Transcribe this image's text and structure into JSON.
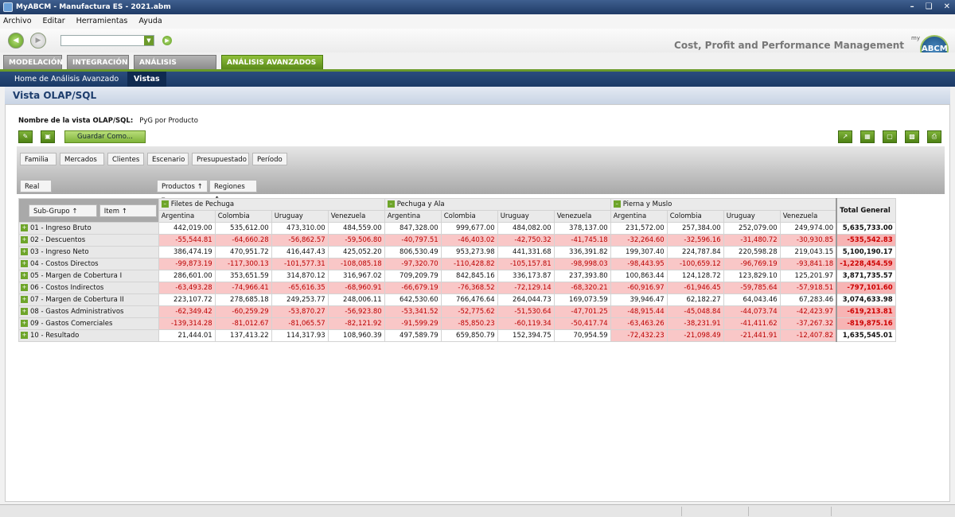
{
  "window": {
    "title": "MyABCM - Manufactura ES - 2021.abm"
  },
  "menu": [
    "Archivo",
    "Editar",
    "Herramientas",
    "Ayuda"
  ],
  "brand": {
    "tagline": "Cost, Profit and Performance Management",
    "logo_small": "my",
    "logo": "ABCM"
  },
  "tabs": [
    "MODELACIÓN",
    "INTEGRACIÓN",
    "ANÁLISIS BÁSICOS",
    "ANÁLISIS AVANZADOS"
  ],
  "active_tab": "ANÁLISIS AVANZADOS",
  "subnav": {
    "home": "Home de Análisis Avanzado",
    "current": "Vistas"
  },
  "page": {
    "title": "Vista OLAP/SQL",
    "view_label": "Nombre de la vista OLAP/SQL:",
    "view_name": "PyG por Producto",
    "save_as": "Guardar Como..."
  },
  "filters": [
    "Familia",
    "Mercados",
    "Clientes",
    "Escenario",
    "Presupuestado",
    "Período"
  ],
  "row_filter": "Real",
  "column_fields": [
    "Productos",
    "Regiones"
  ],
  "row_fields": [
    "Sub-Grupo",
    "Item"
  ],
  "products": [
    "Filetes de Pechuga",
    "Pechuga y Ala",
    "Pierna y Muslo"
  ],
  "regions": [
    "Argentina",
    "Colombia",
    "Uruguay",
    "Venezuela"
  ],
  "total_label": "Total General",
  "rows": [
    {
      "label": "01 - Ingreso Bruto",
      "values": [
        "442,019.00",
        "535,612.00",
        "473,310.00",
        "484,559.00",
        "847,328.00",
        "999,677.00",
        "484,082.00",
        "378,137.00",
        "231,572.00",
        "257,384.00",
        "252,079.00",
        "249,974.00"
      ],
      "total": "5,635,733.00"
    },
    {
      "label": "02 - Descuentos",
      "values": [
        "-55,544.81",
        "-64,660.28",
        "-56,862.57",
        "-59,506.80",
        "-40,797.51",
        "-46,403.02",
        "-42,750.32",
        "-41,745.18",
        "-32,264.60",
        "-32,596.16",
        "-31,480.72",
        "-30,930.85"
      ],
      "total": "-535,542.83"
    },
    {
      "label": "03 - Ingreso Neto",
      "values": [
        "386,474.19",
        "470,951.72",
        "416,447.43",
        "425,052.20",
        "806,530.49",
        "953,273.98",
        "441,331.68",
        "336,391.82",
        "199,307.40",
        "224,787.84",
        "220,598.28",
        "219,043.15"
      ],
      "total": "5,100,190.17"
    },
    {
      "label": "04 - Costos Directos",
      "values": [
        "-99,873.19",
        "-117,300.13",
        "-101,577.31",
        "-108,085.18",
        "-97,320.70",
        "-110,428.82",
        "-105,157.81",
        "-98,998.03",
        "-98,443.95",
        "-100,659.12",
        "-96,769.19",
        "-93,841.18"
      ],
      "total": "-1,228,454.59"
    },
    {
      "label": "05 - Margen de Cobertura I",
      "values": [
        "286,601.00",
        "353,651.59",
        "314,870.12",
        "316,967.02",
        "709,209.79",
        "842,845.16",
        "336,173.87",
        "237,393.80",
        "100,863.44",
        "124,128.72",
        "123,829.10",
        "125,201.97"
      ],
      "total": "3,871,735.57"
    },
    {
      "label": "06 - Costos Indirectos",
      "values": [
        "-63,493.28",
        "-74,966.41",
        "-65,616.35",
        "-68,960.91",
        "-66,679.19",
        "-76,368.52",
        "-72,129.14",
        "-68,320.21",
        "-60,916.97",
        "-61,946.45",
        "-59,785.64",
        "-57,918.51"
      ],
      "total": "-797,101.60"
    },
    {
      "label": "07 - Margen de Cobertura II",
      "values": [
        "223,107.72",
        "278,685.18",
        "249,253.77",
        "248,006.11",
        "642,530.60",
        "766,476.64",
        "264,044.73",
        "169,073.59",
        "39,946.47",
        "62,182.27",
        "64,043.46",
        "67,283.46"
      ],
      "total": "3,074,633.98"
    },
    {
      "label": "08 - Gastos Administrativos",
      "values": [
        "-62,349.42",
        "-60,259.29",
        "-53,870.27",
        "-56,923.80",
        "-53,341.52",
        "-52,775.62",
        "-51,530.64",
        "-47,701.25",
        "-48,915.44",
        "-45,048.84",
        "-44,073.74",
        "-42,423.97"
      ],
      "total": "-619,213.81"
    },
    {
      "label": "09 - Gastos Comerciales",
      "values": [
        "-139,314.28",
        "-81,012.67",
        "-81,065.57",
        "-82,121.92",
        "-91,599.29",
        "-85,850.23",
        "-60,119.34",
        "-50,417.74",
        "-63,463.26",
        "-38,231.91",
        "-41,411.62",
        "-37,267.32"
      ],
      "total": "-819,875.16"
    },
    {
      "label": "10 - Resultado",
      "values": [
        "21,444.01",
        "137,413.22",
        "114,317.93",
        "108,960.39",
        "497,589.79",
        "659,850.79",
        "152,394.75",
        "70,954.59",
        "-72,432.23",
        "-21,098.49",
        "-21,441.91",
        "-12,407.82"
      ],
      "total": "1,635,545.01"
    }
  ]
}
